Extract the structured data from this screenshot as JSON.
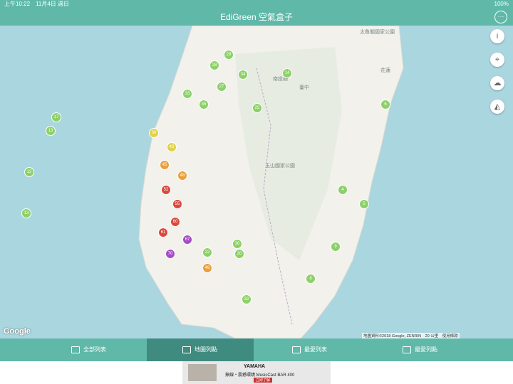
{
  "status": {
    "time_date": "上午10:22　11月4日 週日",
    "battery": "100%"
  },
  "nav": {
    "title": "EdiGreen 空氣盒子",
    "more_icon": "more-icon"
  },
  "map": {
    "labels": [
      "太魯閣國家公園",
      "南投縣",
      "臺中",
      "玉山國家公園",
      "花蓮"
    ],
    "google": "Google",
    "attribution": "地圖資料©2018 Google, ZENRIN　20 公里　使用條款",
    "side_buttons": [
      "info-icon",
      "location-icon",
      "weather-icon",
      "layers-icon"
    ],
    "colors": {
      "good": "#8dd06a",
      "moderate": "#e0d24a",
      "sensitive": "#e9a03c",
      "unhealthy": "#d9493e",
      "very_unhealthy": "#a64bc8"
    },
    "readings": [
      {
        "v": "29",
        "lvl": "good"
      },
      {
        "v": "28",
        "lvl": "good"
      },
      {
        "v": "34",
        "lvl": "good"
      },
      {
        "v": "27",
        "lvl": "good"
      },
      {
        "v": "33",
        "lvl": "good"
      },
      {
        "v": "35",
        "lvl": "good"
      },
      {
        "v": "17",
        "lvl": "good"
      },
      {
        "v": "13",
        "lvl": "good"
      },
      {
        "v": "12",
        "lvl": "good"
      },
      {
        "v": "13",
        "lvl": "good"
      },
      {
        "v": "14",
        "lvl": "good"
      },
      {
        "v": "25",
        "lvl": "good"
      },
      {
        "v": "36",
        "lvl": "moderate"
      },
      {
        "v": "43",
        "lvl": "moderate"
      },
      {
        "v": "45",
        "lvl": "sensitive"
      },
      {
        "v": "48",
        "lvl": "sensitive"
      },
      {
        "v": "52",
        "lvl": "unhealthy"
      },
      {
        "v": "55",
        "lvl": "unhealthy"
      },
      {
        "v": "60",
        "lvl": "unhealthy"
      },
      {
        "v": "61",
        "lvl": "unhealthy"
      },
      {
        "v": "67",
        "lvl": "very_unhealthy"
      },
      {
        "v": "70",
        "lvl": "very_unhealthy"
      },
      {
        "v": "49",
        "lvl": "sensitive"
      },
      {
        "v": "32",
        "lvl": "good"
      },
      {
        "v": "30",
        "lvl": "good"
      },
      {
        "v": "22",
        "lvl": "good"
      },
      {
        "v": "20",
        "lvl": "good"
      },
      {
        "v": "6",
        "lvl": "good"
      },
      {
        "v": "5",
        "lvl": "good"
      },
      {
        "v": "4",
        "lvl": "good"
      },
      {
        "v": "9",
        "lvl": "good"
      },
      {
        "v": "8",
        "lvl": "good"
      }
    ]
  },
  "tabs": [
    {
      "label": "全部列表",
      "active": false
    },
    {
      "label": "地圖列點",
      "active": true
    },
    {
      "label": "最愛列表",
      "active": false
    },
    {
      "label": "最愛列點",
      "active": false
    }
  ],
  "ad": {
    "brand": "YAMAHA",
    "text": "無線・震撼環繞 MusicCast BAR 400",
    "cta": "立即了解"
  }
}
